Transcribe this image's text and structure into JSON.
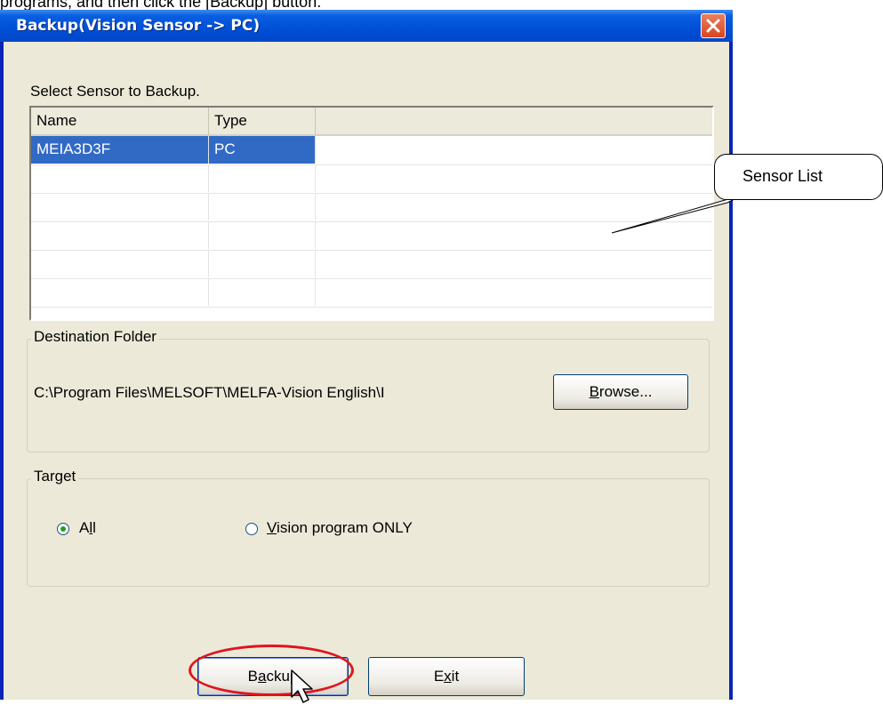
{
  "page_caption": "programs, and then click the [Backup] button.",
  "window": {
    "title": "Backup(Vision Sensor -> PC)",
    "colors": {
      "titlebar": "#0050d8",
      "client": "#ece9d8",
      "selection": "#316ac5",
      "highlight": "#e0151b"
    }
  },
  "sensor_section": {
    "label": "Select Sensor to Backup.",
    "columns": [
      "Name",
      "Type"
    ],
    "rows": [
      {
        "name": "MEIA3D3F",
        "type": "PC",
        "selected": true
      },
      {
        "name": "",
        "type": ""
      },
      {
        "name": "",
        "type": ""
      },
      {
        "name": "",
        "type": ""
      },
      {
        "name": "",
        "type": ""
      },
      {
        "name": "",
        "type": ""
      }
    ]
  },
  "destination": {
    "group_label": "Destination Folder",
    "path": "C:\\Program Files\\MELSOFT\\MELFA-Vision English\\I",
    "browse_pre": "",
    "browse_key": "B",
    "browse_post": "rowse..."
  },
  "target": {
    "group_label": "Target",
    "options": [
      {
        "pre": "A",
        "key": "l",
        "post": "l",
        "selected": true
      },
      {
        "pre": "",
        "key": "V",
        "post": "ision program ONLY",
        "selected": false
      }
    ]
  },
  "buttons": {
    "backup": {
      "pre": "B",
      "key": "a",
      "post": "ckup"
    },
    "exit": {
      "pre": "E",
      "key": "x",
      "post": "it"
    }
  },
  "annotation": {
    "callout_text": "Sensor List"
  }
}
